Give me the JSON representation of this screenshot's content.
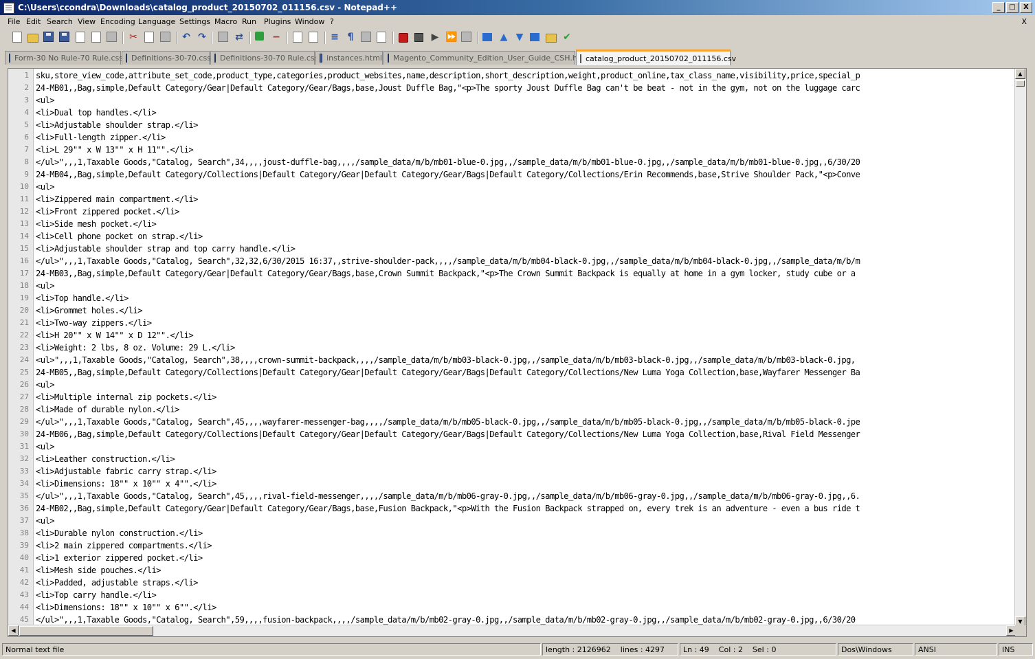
{
  "window": {
    "title": "C:\\Users\\ccondra\\Downloads\\catalog_product_20150702_011156.csv - Notepad++",
    "minimize": "_",
    "restore": "□",
    "close": "X"
  },
  "menu": {
    "items": [
      "File",
      "Edit",
      "Search",
      "View",
      "Encoding",
      "Language",
      "Settings",
      "Macro",
      "Run",
      "Plugins",
      "Window",
      "?"
    ],
    "close_doc": "X"
  },
  "toolbar": {
    "icons": [
      "new-file-icon",
      "open-file-icon",
      "save-icon",
      "save-all-icon",
      "close-icon",
      "close-all-icon",
      "print-icon",
      "cut-icon",
      "copy-icon",
      "paste-icon",
      "undo-icon",
      "redo-icon",
      "find-icon",
      "replace-icon",
      "zoom-in-icon",
      "zoom-out-icon",
      "sync-v-icon",
      "sync-h-icon",
      "word-wrap-icon",
      "show-all-chars-icon",
      "indent-guide-icon",
      "doc-map-icon",
      "record-macro-icon",
      "stop-record-icon",
      "play-macro-icon",
      "play-multiple-icon",
      "save-macro-icon",
      "fold-all-icon",
      "move-up-icon",
      "move-down-icon",
      "compare-icon",
      "folder-workspace-icon",
      "spellcheck-icon"
    ]
  },
  "tabs": [
    {
      "label": "Form-30 No Rule-70 Rule.css",
      "active": false
    },
    {
      "label": "Definitions-30-70.css",
      "active": false
    },
    {
      "label": "Definitions-30-70 Rule.css",
      "active": false
    },
    {
      "label": "instances.html",
      "active": false
    },
    {
      "label": "Magento_Community_Edition_User_Guide_CSH.html",
      "active": false
    },
    {
      "label": "catalog_product_20150702_011156.csv",
      "active": true
    }
  ],
  "editor": {
    "line_numbers": [
      "1",
      "2",
      "3",
      "4",
      "5",
      "6",
      "7",
      "8",
      "9",
      "10",
      "11",
      "12",
      "13",
      "14",
      "15",
      "16",
      "17",
      "18",
      "19",
      "20",
      "21",
      "22",
      "23",
      "24",
      "25",
      "26",
      "27",
      "28",
      "29",
      "30",
      "31",
      "32",
      "33",
      "34",
      "35",
      "36",
      "37",
      "38",
      "39",
      "40",
      "41",
      "42",
      "43",
      "44",
      "45"
    ],
    "lines": [
      "sku,store_view_code,attribute_set_code,product_type,categories,product_websites,name,description,short_description,weight,product_online,tax_class_name,visibility,price,special_p",
      "24-MB01,,Bag,simple,Default Category/Gear|Default Category/Gear/Bags,base,Joust Duffle Bag,\"<p>The sporty Joust Duffle Bag can't be beat - not in the gym, not on the luggage carc",
      "<ul>",
      "<li>Dual top handles.</li>",
      "<li>Adjustable shoulder strap.</li>",
      "<li>Full-length zipper.</li>",
      "<li>L 29\"\" x W 13\"\" x H 11\"\".</li>",
      "</ul>\",,,1,Taxable Goods,\"Catalog, Search\",34,,,,joust-duffle-bag,,,,/sample_data/m/b/mb01-blue-0.jpg,,/sample_data/m/b/mb01-blue-0.jpg,,/sample_data/m/b/mb01-blue-0.jpg,,6/30/20",
      "24-MB04,,Bag,simple,Default Category/Collections|Default Category/Gear|Default Category/Gear/Bags|Default Category/Collections/Erin Recommends,base,Strive Shoulder Pack,\"<p>Conve",
      "<ul>",
      "<li>Zippered main compartment.</li>",
      "<li>Front zippered pocket.</li>",
      "<li>Side mesh pocket.</li>",
      "<li>Cell phone pocket on strap.</li>",
      "<li>Adjustable shoulder strap and top carry handle.</li>",
      "</ul>\",,,1,Taxable Goods,\"Catalog, Search\",32,32,6/30/2015 16:37,,strive-shoulder-pack,,,,/sample_data/m/b/mb04-black-0.jpg,,/sample_data/m/b/mb04-black-0.jpg,,/sample_data/m/b/m",
      "24-MB03,,Bag,simple,Default Category/Gear|Default Category/Gear/Bags,base,Crown Summit Backpack,\"<p>The Crown Summit Backpack is equally at home in a gym locker, study cube or a",
      "<ul>",
      "<li>Top handle.</li>",
      "<li>Grommet holes.</li>",
      "<li>Two-way zippers.</li>",
      "<li>H 20\"\" x W 14\"\" x D 12\"\".</li>",
      "<li>Weight: 2 lbs, 8 oz. Volume: 29 L.</li>",
      "<ul>\",,,1,Taxable Goods,\"Catalog, Search\",38,,,,crown-summit-backpack,,,,/sample_data/m/b/mb03-black-0.jpg,,/sample_data/m/b/mb03-black-0.jpg,,/sample_data/m/b/mb03-black-0.jpg,",
      "24-MB05,,Bag,simple,Default Category/Collections|Default Category/Gear|Default Category/Gear/Bags|Default Category/Collections/New Luma Yoga Collection,base,Wayfarer Messenger Ba",
      "<ul>",
      "<li>Multiple internal zip pockets.</li>",
      "<li>Made of durable nylon.</li>",
      "</ul>\",,,1,Taxable Goods,\"Catalog, Search\",45,,,,wayfarer-messenger-bag,,,,/sample_data/m/b/mb05-black-0.jpg,,/sample_data/m/b/mb05-black-0.jpg,,/sample_data/m/b/mb05-black-0.jpe",
      "24-MB06,,Bag,simple,Default Category/Collections|Default Category/Gear|Default Category/Gear/Bags|Default Category/Collections/New Luma Yoga Collection,base,Rival Field Messenger",
      "<ul>",
      "<li>Leather construction.</li>",
      "<li>Adjustable fabric carry strap.</li>",
      "<li>Dimensions: 18\"\" x 10\"\" x 4\"\".</li>",
      "</ul>\",,,1,Taxable Goods,\"Catalog, Search\",45,,,,rival-field-messenger,,,,/sample_data/m/b/mb06-gray-0.jpg,,/sample_data/m/b/mb06-gray-0.jpg,,/sample_data/m/b/mb06-gray-0.jpg,,6.",
      "24-MB02,,Bag,simple,Default Category/Gear|Default Category/Gear/Bags,base,Fusion Backpack,\"<p>With the Fusion Backpack strapped on, every trek is an adventure - even a bus ride t",
      "<ul>",
      "<li>Durable nylon construction.</li>",
      "<li>2 main zippered compartments.</li>",
      "<li>1 exterior zippered pocket.</li>",
      "<li>Mesh side pouches.</li>",
      "<li>Padded, adjustable straps.</li>",
      "<li>Top carry handle.</li>",
      "<li>Dimensions: 18\"\" x 10\"\" x 6\"\".</li>",
      "</ul>\",,,1,Taxable Goods,\"Catalog, Search\",59,,,,fusion-backpack,,,,/sample_data/m/b/mb02-gray-0.jpg,,/sample_data/m/b/mb02-gray-0.jpg,,/sample_data/m/b/mb02-gray-0.jpg,,6/30/20"
    ]
  },
  "status": {
    "file_type": "Normal text file",
    "length": "length : 2126962",
    "lines": "lines : 4297",
    "position": "Ln : 49    Col : 2    Sel : 0",
    "eol": "Dos\\Windows",
    "encoding": "ANSI",
    "mode": "INS"
  },
  "colors": {
    "tab_active_accent": "#f7a530",
    "title_gradient_start": "#0a246a",
    "title_gradient_end": "#a6caf0"
  }
}
